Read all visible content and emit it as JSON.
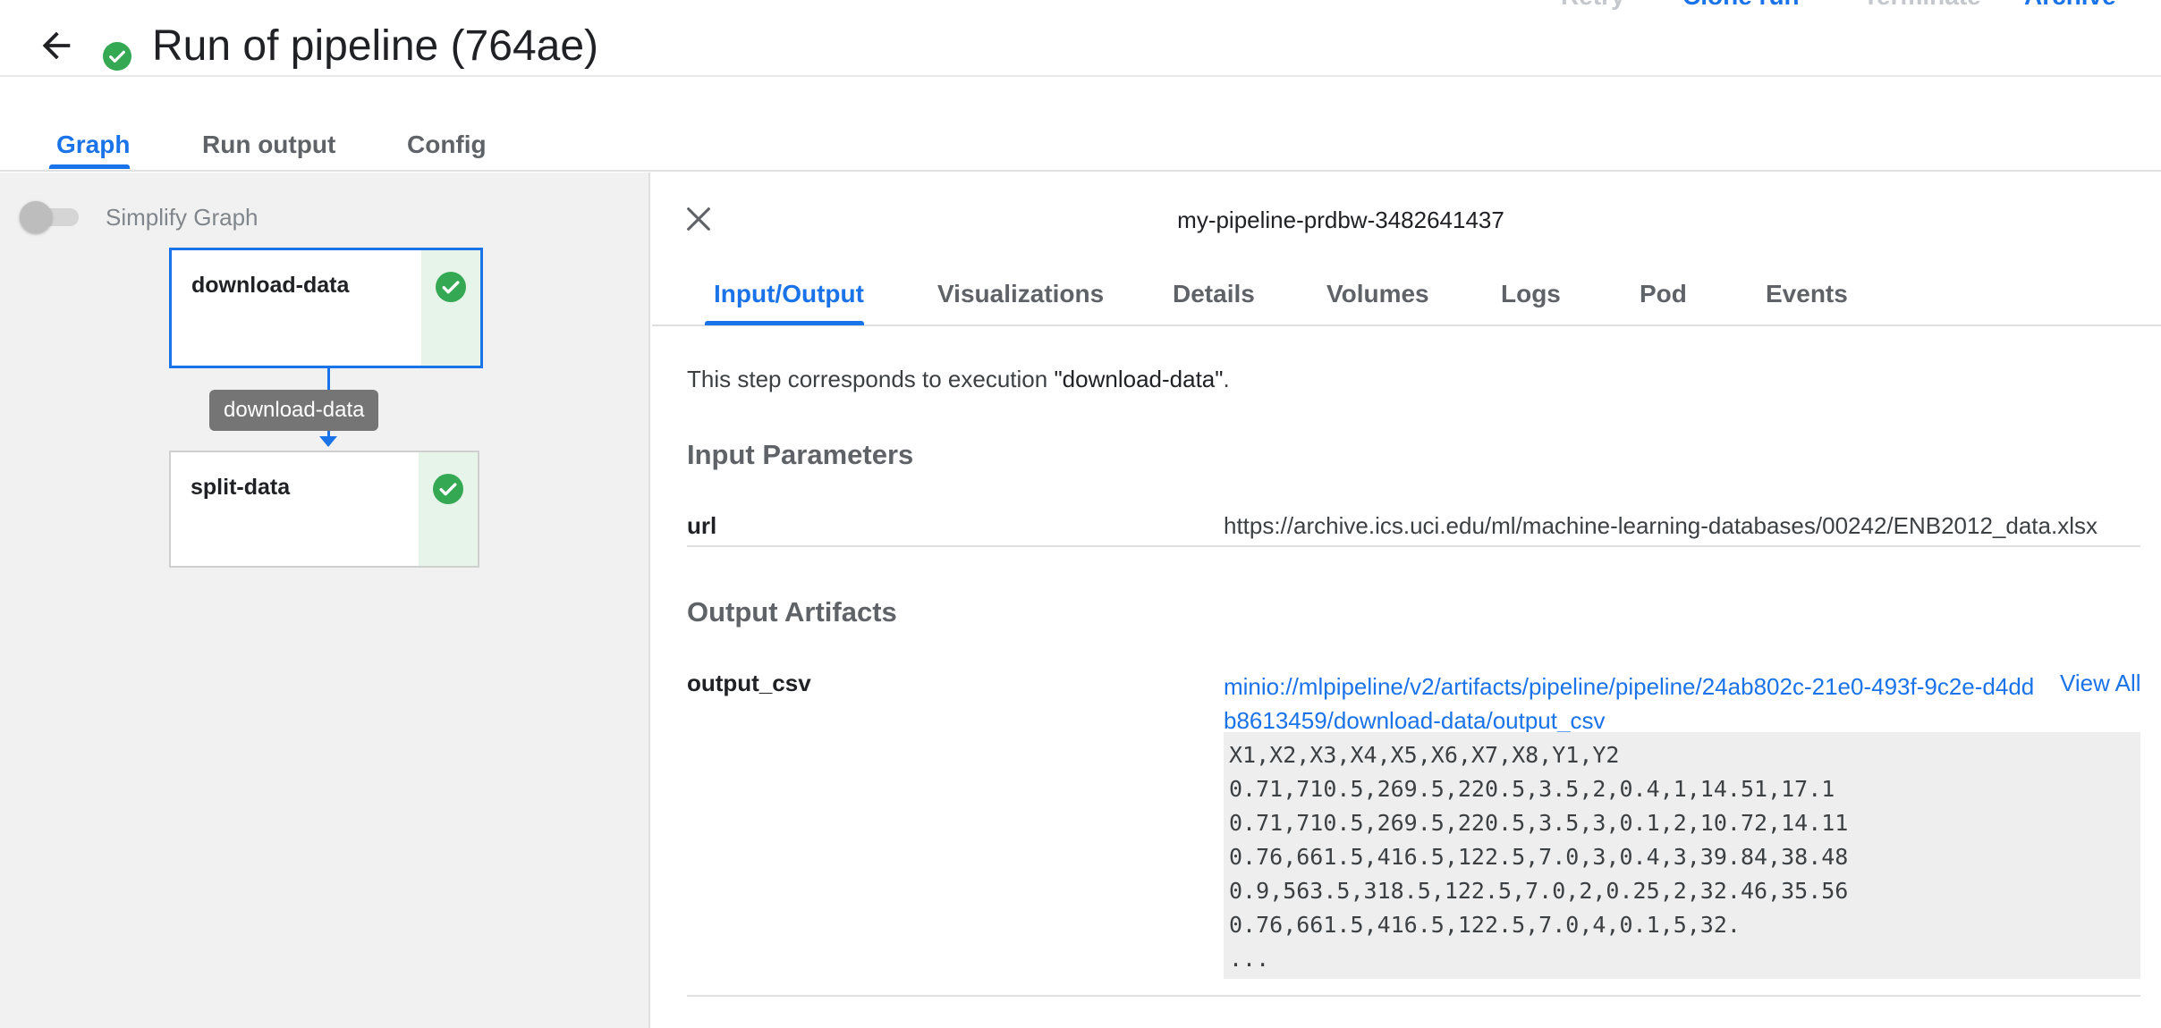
{
  "header": {
    "title": "Run of pipeline (764ae)",
    "actions": {
      "retry": "Retry",
      "clone_run": "Clone run",
      "terminate": "Terminate",
      "archive": "Archive"
    }
  },
  "tabs": {
    "graph": "Graph",
    "run_output": "Run output",
    "config": "Config",
    "active": "Graph"
  },
  "graph": {
    "simplify_toggle": {
      "label": "Simplify Graph",
      "enabled": false
    },
    "nodes": [
      {
        "label": "download-data",
        "status": "succeeded",
        "selected": true
      },
      {
        "label": "split-data",
        "status": "succeeded",
        "selected": false
      }
    ],
    "edge_tooltip": "download-data"
  },
  "side_panel": {
    "title": "my-pipeline-prdbw-3482641437",
    "tabs": [
      "Input/Output",
      "Visualizations",
      "Details",
      "Volumes",
      "Logs",
      "Pod",
      "Events"
    ],
    "active_tab": "Input/Output",
    "step_info": {
      "prefix": "This step corresponds to execution ",
      "execution": "\"download-data\"",
      "suffix": "."
    },
    "input_parameters": {
      "title": "Input Parameters",
      "rows": [
        {
          "key": "url",
          "value": "https://archive.ics.uci.edu/ml/machine-learning-databases/00242/ENB2012_data.xlsx"
        }
      ]
    },
    "output_artifacts": {
      "title": "Output Artifacts",
      "rows": [
        {
          "key": "output_csv",
          "uri": "minio://mlpipeline/v2/artifacts/pipeline/pipeline/24ab802c-21e0-493f-9c2e-d4ddb8613459/download-data/output_csv",
          "view_all": "View All",
          "preview": [
            "X1,X2,X3,X4,X5,X6,X7,X8,Y1,Y2",
            "0.71,710.5,269.5,220.5,3.5,2,0.4,1,14.51,17.1",
            "0.71,710.5,269.5,220.5,3.5,3,0.1,2,10.72,14.11",
            "0.76,661.5,416.5,122.5,7.0,3,0.4,3,39.84,38.48",
            "0.9,563.5,318.5,122.5,7.0,2,0.25,2,32.46,35.56",
            "0.76,661.5,416.5,122.5,7.0,4,0.1,5,32.",
            "..."
          ]
        }
      ]
    }
  },
  "colors": {
    "accent": "#1a73e8",
    "success": "#34a853",
    "success_bg": "#e6f4ea",
    "disabled": "#c4c7cb",
    "graph_bg": "#f1f1f1",
    "tooltip_bg": "#757575"
  },
  "icons": {
    "back": "arrow-left-icon",
    "status": "check-circle-icon",
    "close": "close-icon"
  }
}
